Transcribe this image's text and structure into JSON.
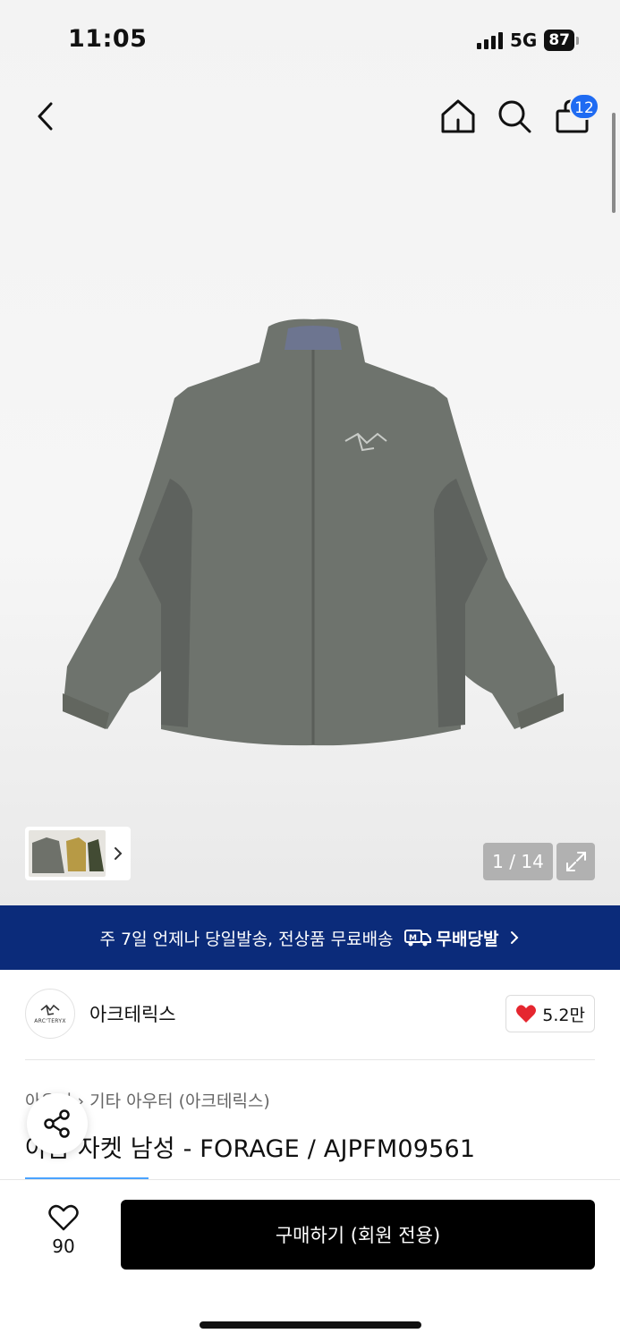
{
  "status_bar": {
    "time": "11:05",
    "network": "5G",
    "battery": "87"
  },
  "nav": {
    "cart_count": "12"
  },
  "gallery": {
    "page_counter": "1 / 14"
  },
  "banner": {
    "text": "주 7일 언제나 당일발송, 전상품 무료배송",
    "tag": "무배당발"
  },
  "brand": {
    "logo_text": "ARC'TERYX",
    "name": "아크테릭스",
    "likes": "5.2만"
  },
  "product": {
    "breadcrumb_cut": "아우터",
    "breadcrumb": "기타 아우터 (아크테릭스)",
    "title": "아톰 자켓 남성 - FORAGE / AJPFM09561"
  },
  "bottom": {
    "wish_count": "90",
    "buy_label": "구매하기 (회원 전용)"
  },
  "colors": {
    "banner_bg": "#0b2b7a",
    "badge": "#1f6bf2",
    "heart": "#e5262f",
    "jacket": "#6e736d"
  }
}
